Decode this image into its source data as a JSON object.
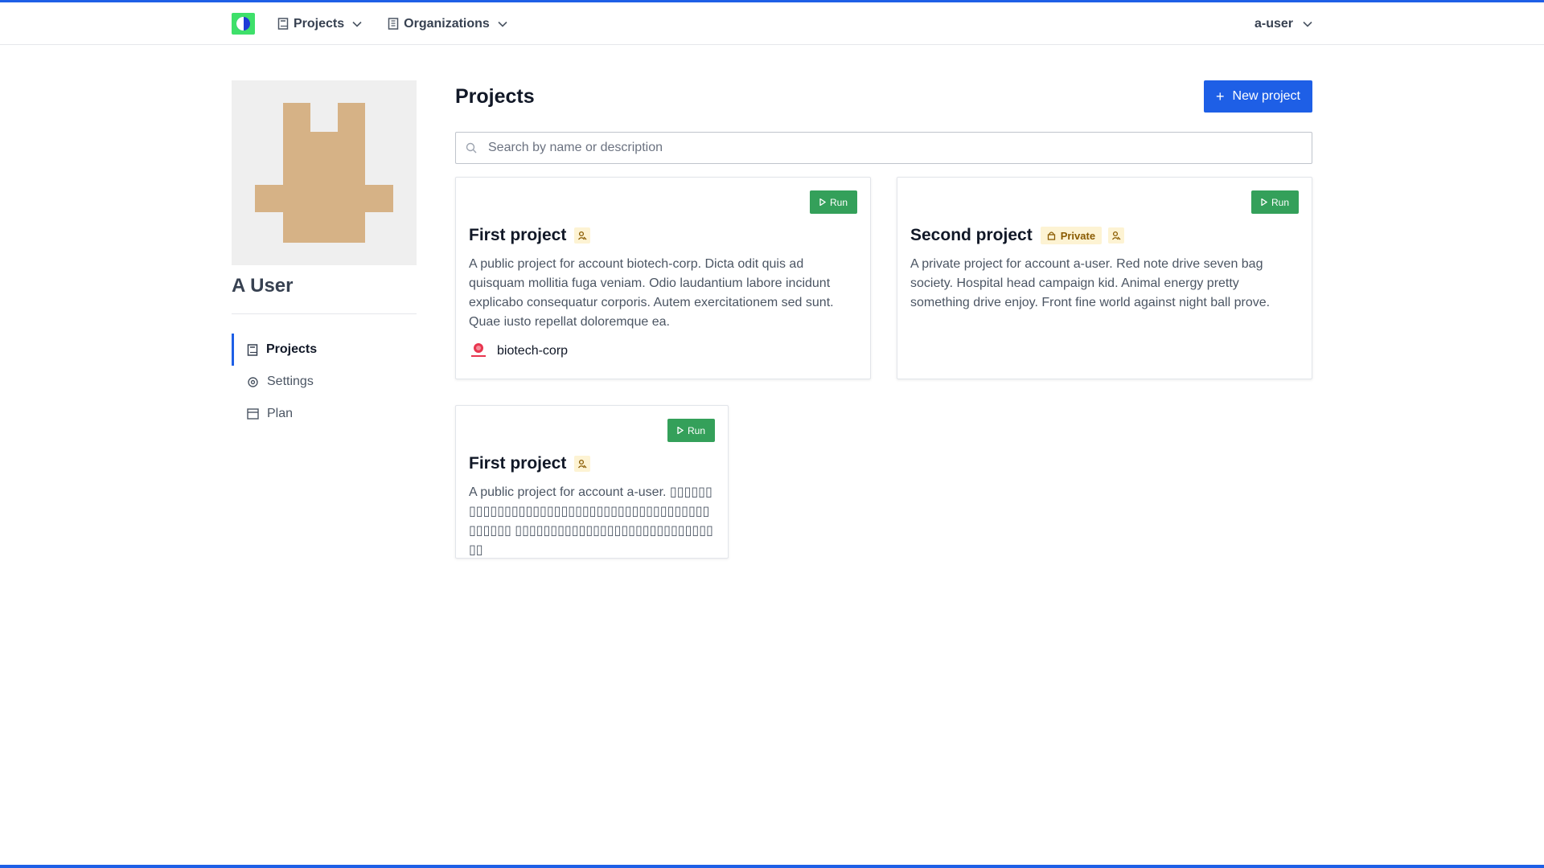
{
  "navbar": {
    "projects_label": "Projects",
    "organizations_label": "Organizations",
    "user_label": "a-user"
  },
  "profile": {
    "name": "A User"
  },
  "sidebar": {
    "items": [
      {
        "label": "Projects",
        "icon": "book-icon",
        "active": true
      },
      {
        "label": "Settings",
        "icon": "settings-icon",
        "active": false
      },
      {
        "label": "Plan",
        "icon": "plan-icon",
        "active": false
      }
    ]
  },
  "main": {
    "title": "Projects",
    "new_project_label": "New project",
    "search": {
      "placeholder": "Search by name or description",
      "value": ""
    },
    "projects": [
      {
        "title": "First project",
        "run_label": "Run",
        "private_label": "",
        "description": "A public project for account biotech-corp. Dicta odit quis ad quisquam mollitia fuga veniam. Odio laudantium labore incidunt explicabo consequatur corporis. Autem exercitationem sed sunt. Quae iusto repellat doloremque ea.",
        "org": "biotech-corp"
      },
      {
        "title": "Second project",
        "run_label": "Run",
        "private_label": "Private",
        "description": "A private project for account a-user. Red note drive seven bag society. Hospital head campaign kid. Animal energy pretty something drive enjoy. Front fine world against night ball prove.",
        "org": ""
      },
      {
        "title": "First project",
        "run_label": "Run",
        "private_label": "",
        "description": "A public project for account a-user. ▯▯▯▯▯▯ ▯▯▯▯▯▯▯▯▯▯▯▯▯▯▯▯▯▯▯▯▯▯▯▯▯▯▯▯▯▯▯▯▯▯▯▯▯▯▯▯ ▯▯▯▯▯▯▯▯▯▯▯▯▯▯▯▯▯▯▯▯▯▯▯▯▯▯▯▯▯▯",
        "org": ""
      }
    ]
  },
  "colors": {
    "accent": "#1e5fe6",
    "run_green": "#34a05a",
    "badge_bg": "#fdf3d3",
    "avatar_tan": "#d6b286"
  }
}
